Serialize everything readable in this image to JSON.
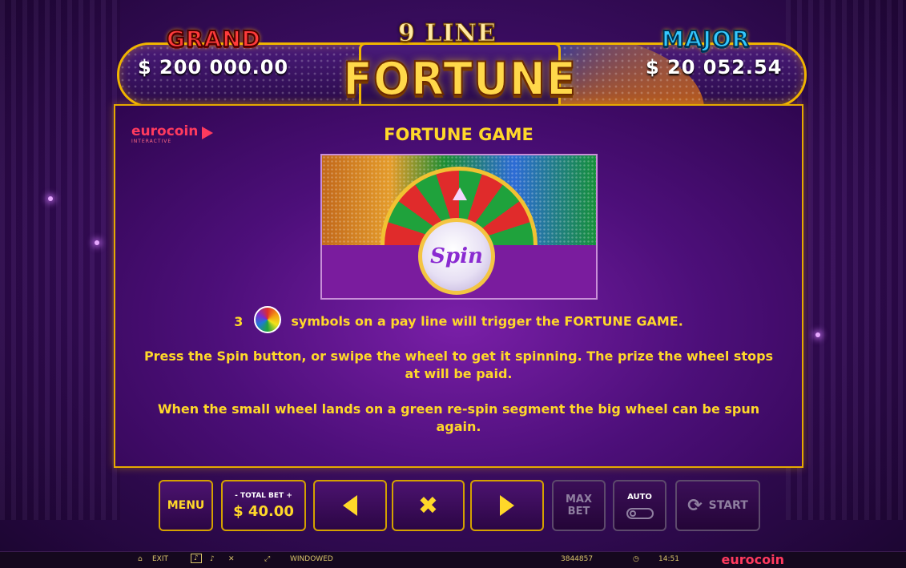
{
  "header": {
    "grand_label": "GRAND",
    "grand_value": "$ 200 000.00",
    "major_label": "MAJOR",
    "major_value": "$ 20 052.54",
    "logo_top": "9 LINE",
    "logo_main": "FORTUNE"
  },
  "panel": {
    "brand": "eurocoin",
    "brand_sub": "INTERACTIVE",
    "title": "FORTUNE GAME",
    "spin_label": "Spin",
    "line1_count": "3",
    "line1_text": "symbols on a pay line will trigger the FORTUNE GAME.",
    "paragraph1": "Press the Spin button, or swipe the wheel to get it spinning. The prize the wheel stops at will be paid.",
    "paragraph2": "When the small wheel lands on a green re-spin segment the big wheel can be spun again."
  },
  "controls": {
    "menu": "MENU",
    "total_bet_label": "-  TOTAL BET  +",
    "total_bet_value": "$ 40.00",
    "close_glyph": "✖",
    "max_bet_line1": "MAX",
    "max_bet_line2": "BET",
    "auto": "AUTO",
    "start": "START",
    "start_glyph": "⟳"
  },
  "statusbar": {
    "exit": "EXIT",
    "windowed": "WINDOWED",
    "session_id": "3844857",
    "clock_glyph": "◷",
    "time": "14:51",
    "brand": "eurocoin"
  },
  "colors": {
    "accent_gold": "#ffd829",
    "frame_gold": "#f0b400",
    "background_purple": "#4d0f7a",
    "grand_red": "#ff3b3b",
    "major_blue": "#33c8ff"
  },
  "icons": [
    "wheel-symbol-icon",
    "arrow-left-icon",
    "close-icon",
    "arrow-right-icon",
    "toggle-icon",
    "refresh-icon",
    "home-icon",
    "sound-icon",
    "fullscreen-icon",
    "clock-icon"
  ]
}
